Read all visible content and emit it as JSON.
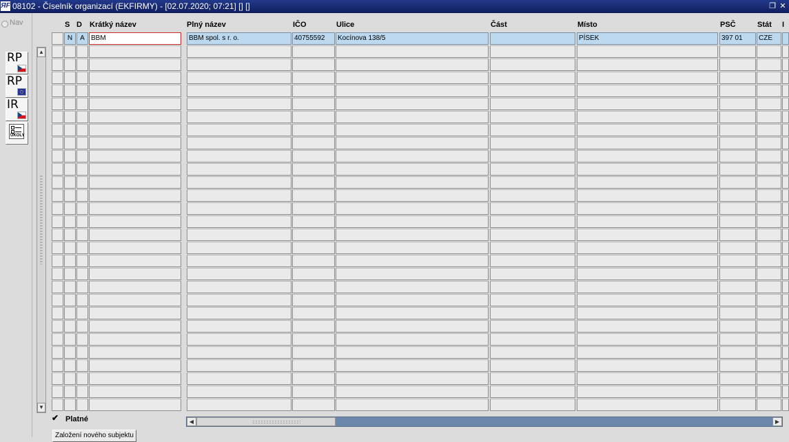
{
  "window": {
    "title": "08102 - Číselník organizací (EKFIRMY) - [02.07.2020; 07:21]  []  []",
    "logo_text": "ЯF",
    "restore_icon": "restore-icon",
    "close_icon": "close-icon"
  },
  "left_panel": {
    "nav_label": "Nav",
    "buttons": [
      {
        "label": "RP",
        "icon": "czech-flag-icon"
      },
      {
        "label": "RP",
        "icon": "eu-flag-icon"
      },
      {
        "label": "IR",
        "icon": "czech-flag-icon"
      },
      {
        "label": "ÚKOLY",
        "icon": "tasks-icon"
      }
    ]
  },
  "table": {
    "headers": {
      "s": "S",
      "d": "D",
      "kratky_nazev": "Krátký název",
      "plny_nazev": "Plný název",
      "ico": "IČO",
      "ulice": "Ulice",
      "cast": "Část",
      "misto": "Místo",
      "psc": "PSČ",
      "stat": "Stát",
      "more": "I"
    },
    "rows": [
      {
        "s": "N",
        "d": "A",
        "kratky_nazev": "BBM",
        "plny_nazev": "BBM spol. s r. o.",
        "ico": "40755592",
        "ulice": "Kocínova 138/5",
        "cast": "",
        "misto": "PÍSEK",
        "psc": "397 01",
        "stat": "CZE"
      }
    ],
    "visible_row_count": 29
  },
  "footer": {
    "checkbox_checked": true,
    "checkbox_mark": "✔",
    "checkbox_label": "Platné",
    "new_button_label": "Založení nového subjektu"
  }
}
